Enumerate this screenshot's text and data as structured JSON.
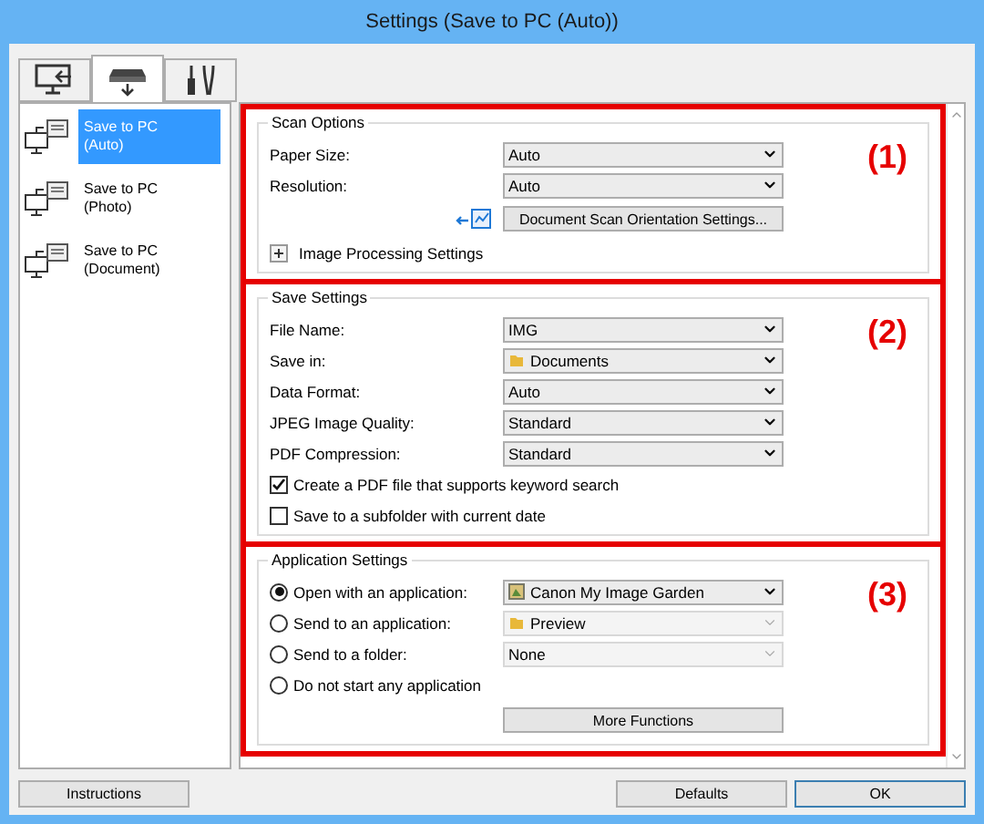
{
  "window": {
    "title": "Settings (Save to PC (Auto))"
  },
  "tabs": [
    {
      "kind": "computer",
      "selected": false
    },
    {
      "kind": "scanner",
      "selected": true
    },
    {
      "kind": "tools",
      "selected": false
    }
  ],
  "sidebar": {
    "items": [
      {
        "label": "Save to PC\n(Auto)",
        "selected": true
      },
      {
        "label": "Save to PC\n(Photo)",
        "selected": false
      },
      {
        "label": "Save to PC\n(Document)",
        "selected": false
      }
    ]
  },
  "scan_options": {
    "title": "Scan Options",
    "callout": "(1)",
    "fields": [
      {
        "label": "Paper Size:",
        "value": "Auto"
      },
      {
        "label": "Resolution:",
        "value": "Auto"
      }
    ],
    "orientation_button": "Document Scan Orientation Settings...",
    "expander": {
      "label": "Image Processing Settings",
      "expanded": false
    }
  },
  "save_settings": {
    "title": "Save Settings",
    "callout": "(2)",
    "fields": [
      {
        "label": "File Name:",
        "value": "IMG"
      },
      {
        "label": "Save in:",
        "value": "Documents",
        "kind": "folder"
      },
      {
        "label": "Data Format:",
        "value": "Auto"
      },
      {
        "label": "JPEG Image Quality:",
        "value": "Standard"
      },
      {
        "label": "PDF Compression:",
        "value": "Standard"
      }
    ],
    "checkboxes": [
      {
        "label": "Create a PDF file that supports keyword search",
        "checked": true
      },
      {
        "label": "Save to a subfolder with current date",
        "checked": false
      }
    ]
  },
  "application_settings": {
    "title": "Application Settings",
    "callout": "(3)",
    "options": [
      {
        "label": "Open with an application:",
        "selected": true,
        "value": "Canon My Image Garden",
        "kind": "app",
        "disabled": false
      },
      {
        "label": "Send to an application:",
        "selected": false,
        "value": "Preview",
        "kind": "folder",
        "disabled": true
      },
      {
        "label": "Send to a folder:",
        "selected": false,
        "value": "None",
        "disabled": true
      },
      {
        "label": "Do not start any application",
        "selected": false
      }
    ],
    "button": "More Functions"
  },
  "buttons": {
    "instructions": "Instructions",
    "defaults": "Defaults",
    "ok": "OK"
  }
}
